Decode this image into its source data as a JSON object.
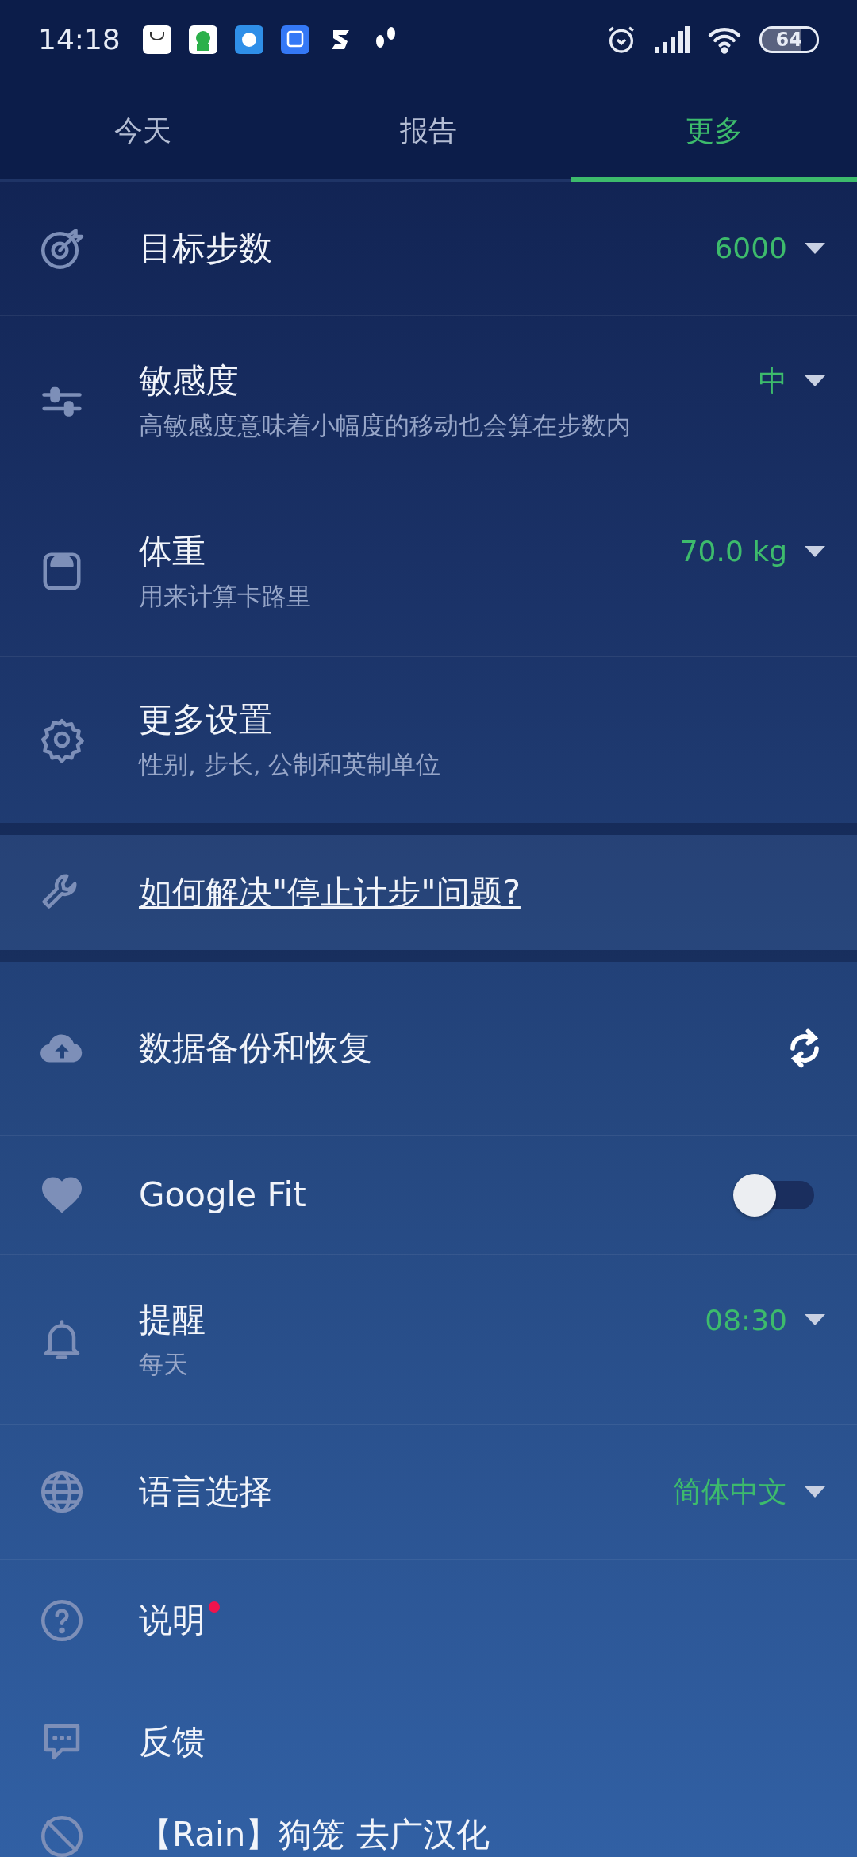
{
  "status_bar": {
    "time": "14:18",
    "battery": "64"
  },
  "tabs": [
    {
      "label": "今天",
      "selected": false
    },
    {
      "label": "报告",
      "selected": false
    },
    {
      "label": "更多",
      "selected": true
    }
  ],
  "settings": [
    {
      "kind": "dropdown",
      "title": "目标步数",
      "value": "6000"
    },
    {
      "kind": "dropdown",
      "title": "敏感度",
      "subtitle": "高敏感度意味着小幅度的移动也会算在步数内",
      "value": "中"
    },
    {
      "kind": "dropdown",
      "title": "体重",
      "subtitle": "用来计算卡路里",
      "value": "70.0 kg"
    },
    {
      "kind": "link",
      "title": "更多设置",
      "subtitle": "性别, 步长, 公制和英制单位"
    }
  ],
  "help_link": "如何解决\"停止计步\"问题?",
  "more": [
    {
      "kind": "action",
      "title": "数据备份和恢复"
    },
    {
      "kind": "toggle",
      "title": "Google Fit",
      "on": false
    },
    {
      "kind": "dropdown",
      "title": "提醒",
      "subtitle": "每天",
      "value": "08:30"
    },
    {
      "kind": "dropdown",
      "title": "语言选择",
      "value": "简体中文"
    },
    {
      "kind": "link",
      "title": "说明",
      "new_badge": true
    },
    {
      "kind": "link",
      "title": "反馈"
    },
    {
      "kind": "link",
      "title": "【Rain】狗笼 去广汉化"
    }
  ]
}
